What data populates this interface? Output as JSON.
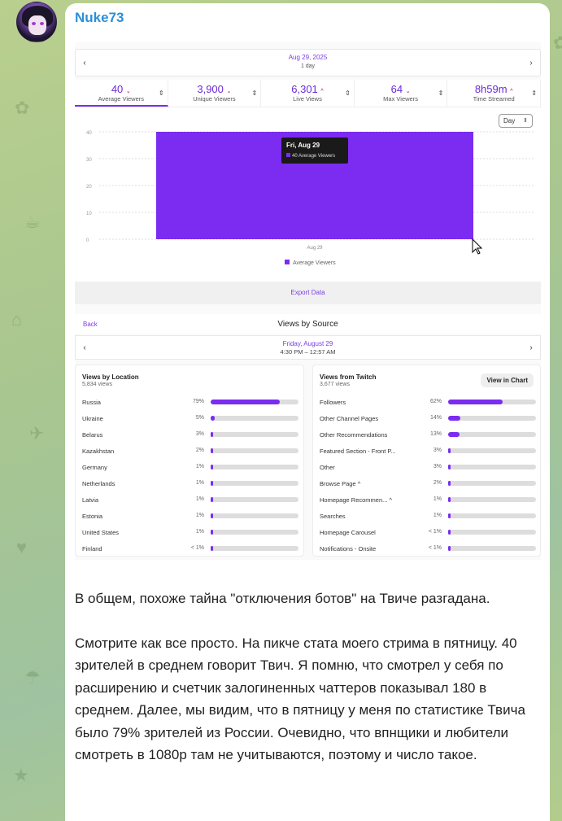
{
  "message": {
    "author": "Nuke73",
    "text_p1": "В общем, похоже тайна \"отключения ботов\" на Твиче разгадана.",
    "text_p2": "Смотрите как все просто. На пикче стата моего стрима в пятницу. 40 зрителей в среднем говорит Твич. Я помню, что смотрел у себя по расширению и счетчик залогиненных чаттеров показывал 180 в среднем. Далее, мы видим, что в пятницу у меня по статистике Твича было 79% зрителей из России. Очевидно, что впнщики и любители смотреть в 1080р там не учитываются, поэтому и число такое."
  },
  "datebar": {
    "date": "Aug 29, 2025",
    "range": "1 day",
    "prev": "‹",
    "next": "›"
  },
  "stats": [
    {
      "value": "40",
      "trend": "⌄",
      "label": "Average Viewers"
    },
    {
      "value": "3,900",
      "trend": "⌄",
      "label": "Unique Viewers"
    },
    {
      "value": "6,301",
      "trend": "^",
      "label": "Live Views"
    },
    {
      "value": "64",
      "trend": "⌄",
      "label": "Max Viewers"
    },
    {
      "value": "8h59m",
      "trend": "^",
      "label": "Time Streamed"
    }
  ],
  "chart_data": {
    "type": "bar",
    "categories": [
      "Aug 29"
    ],
    "series": [
      {
        "name": "Average Viewers",
        "values": [
          40
        ]
      }
    ],
    "yticks": [
      0,
      10,
      20,
      30,
      40
    ],
    "ylim": [
      0,
      40
    ],
    "tooltip": {
      "title": "Fri, Aug 29",
      "line": "40 Average Viewers"
    },
    "accent": "#7b2cf0"
  },
  "chart_controls": {
    "day_select": "Day",
    "export": "Export Data"
  },
  "views_by_source": {
    "back": "Back",
    "title": "Views by Source",
    "date": "Friday, August 29",
    "time": "4:30 PM – 12:57 AM"
  },
  "location_panel": {
    "title": "Views by Location",
    "subtitle": "5,834 views",
    "rows": [
      {
        "name": "Russia",
        "pct": "79%",
        "v": 0.79
      },
      {
        "name": "Ukraine",
        "pct": "5%",
        "v": 0.05
      },
      {
        "name": "Belarus",
        "pct": "3%",
        "v": 0.03
      },
      {
        "name": "Kazakhstan",
        "pct": "2%",
        "v": 0.02
      },
      {
        "name": "Germany",
        "pct": "1%",
        "v": 0.01
      },
      {
        "name": "Netherlands",
        "pct": "1%",
        "v": 0.01
      },
      {
        "name": "Latvia",
        "pct": "1%",
        "v": 0.01
      },
      {
        "name": "Estonia",
        "pct": "1%",
        "v": 0.01
      },
      {
        "name": "United States",
        "pct": "1%",
        "v": 0.01
      },
      {
        "name": "Finland",
        "pct": "< 1%",
        "v": 0.005
      }
    ]
  },
  "twitch_panel": {
    "title": "Views from Twitch",
    "subtitle": "3,677 views",
    "view_chart": "View in Chart",
    "rows": [
      {
        "name": "Followers",
        "pct": "62%",
        "v": 0.62
      },
      {
        "name": "Other Channel Pages",
        "pct": "14%",
        "v": 0.14
      },
      {
        "name": "Other Recommendations",
        "pct": "13%",
        "v": 0.13
      },
      {
        "name": "Featured Section - Front P...",
        "pct": "3%",
        "v": 0.03
      },
      {
        "name": "Other",
        "pct": "3%",
        "v": 0.03
      },
      {
        "name": "Browse Page ^",
        "pct": "2%",
        "v": 0.02
      },
      {
        "name": "Homepage Recommen... ^",
        "pct": "1%",
        "v": 0.01
      },
      {
        "name": "Searches",
        "pct": "1%",
        "v": 0.01
      },
      {
        "name": "Homepage Carousel",
        "pct": "< 1%",
        "v": 0.005
      },
      {
        "name": "Notifications - Onsite",
        "pct": "< 1%",
        "v": 0.005
      }
    ]
  }
}
